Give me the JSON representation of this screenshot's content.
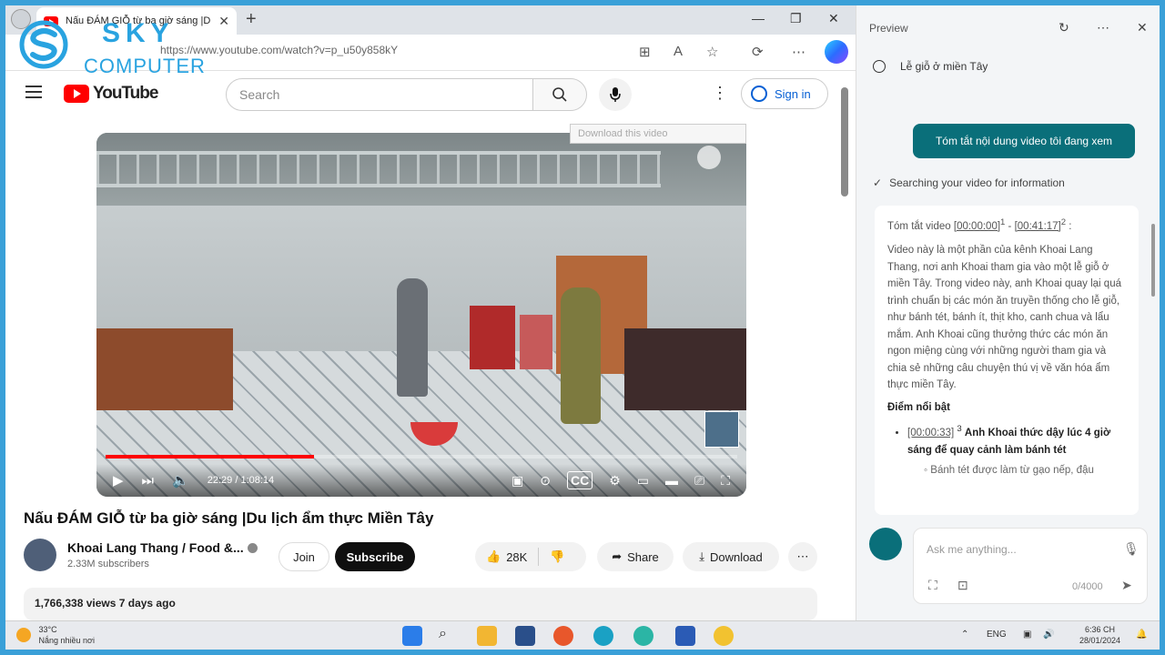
{
  "browser": {
    "tab_title": "Nấu ĐÁM GIỖ từ ba giờ sáng |D",
    "url": "https://www.youtube.com/watch?v=p_u50y858kY"
  },
  "watermark": {
    "line1": "SKY",
    "line2": "COMPUTER"
  },
  "youtube": {
    "logo_text": "YouTube",
    "search_placeholder": "Search",
    "signin_label": "Sign in",
    "download_hint": "Download this video",
    "player": {
      "time": "22:29 / 1:08:14",
      "progress_fraction": 0.33
    },
    "video_title": "Nấu ĐÁM GIỖ từ ba giờ sáng |Du lịch ẩm thực Miền Tây",
    "channel_name": "Khoai Lang Thang / Food &...",
    "subscribers": "2.33M subscribers",
    "join_label": "Join",
    "subscribe_label": "Subscribe",
    "likes": "28K",
    "share_label": "Share",
    "download_label": "Download",
    "description_meta": "1,766,338 views  7 days ago"
  },
  "copilot": {
    "header": "Preview",
    "history_item": "Lễ giỗ ở miền Tây",
    "user_prompt": "Tóm tắt nội dung video tôi đang xem",
    "status": "Searching your video for information",
    "answer": {
      "heading_prefix": "Tóm tắt video ",
      "ts_start": "[00:00:00]",
      "sup1": "1",
      "dash": " - ",
      "ts_end": "[00:41:17]",
      "sup2": "2",
      "colon": " :",
      "body": "Video này là một phần của kênh Khoai Lang Thang, nơi anh Khoai tham gia vào một lễ giỗ ở miền Tây. Trong video này, anh Khoai quay lại quá trình chuẩn bị các món ăn truyền thống cho lễ giỗ, như bánh tét, bánh ít, thịt kho, canh chua và lẩu mắm. Anh Khoai cũng thưởng thức các món ăn ngon miệng cùng với những người tham gia và chia sẻ những câu chuyện thú vị về văn hóa ẩm thực miền Tây.",
      "highlights_label": "Điểm nổi bật",
      "highlight_ts": "[00:00:33]",
      "highlight_sup": "3",
      "highlight_text": "Anh Khoai thức dậy lúc 4 giờ sáng để quay cảnh làm bánh tét",
      "sub_point": "Bánh tét được làm từ gạo nếp, đậu"
    },
    "ask_placeholder": "Ask me anything...",
    "char_count": "0/4000"
  },
  "taskbar": {
    "temp": "33°C",
    "weather_desc": "Nắng nhiều nơi",
    "lang": "ENG",
    "time": "6:36 CH",
    "date": "28/01/2024"
  },
  "colors": {
    "accent_teal": "#0a6f7a",
    "youtube_red": "#ff0000",
    "watermark_blue": "#29a3e0"
  }
}
